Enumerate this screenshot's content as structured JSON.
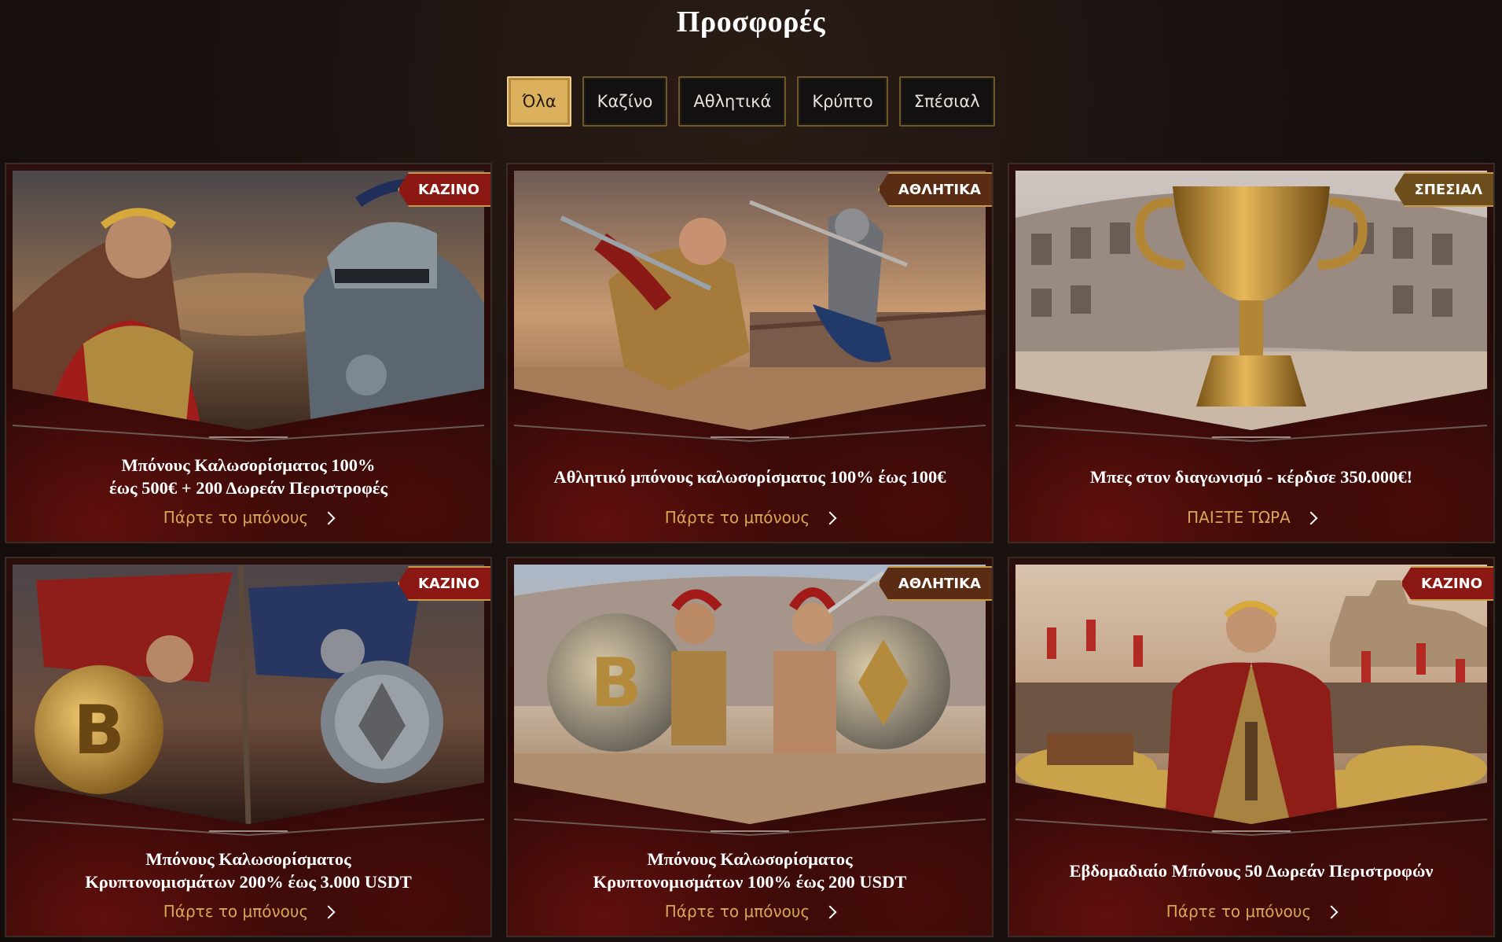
{
  "page": {
    "title": "Προσφορές"
  },
  "filters": [
    {
      "label": "Όλα",
      "active": true
    },
    {
      "label": "Καζίνο",
      "active": false
    },
    {
      "label": "Αθλητικά",
      "active": false
    },
    {
      "label": "Κρύπτο",
      "active": false
    },
    {
      "label": "Σπέσιαλ",
      "active": false
    }
  ],
  "colors": {
    "accent_gold": "#dcb15e",
    "link_gold": "#d8a658",
    "badge_red": "#8c1813",
    "badge_brown": "#5a2c14",
    "badge_gold": "#6e4d1d"
  },
  "offers": [
    {
      "badge": "ΚΑΖΙΝΟ",
      "title": "Μπόνους Καλωσορίσματος 100%\nέως 500€ + 200 Δωρεάν Περιστροφές",
      "cta": "Πάρτε το μπόνους",
      "image": "two-gladiators-laurel-helmet"
    },
    {
      "badge": "ΑΘΛΗΤΙΚΑ",
      "title": "Αθλητικό μπόνους καλωσορίσματος 100% έως 100€",
      "cta": "Πάρτε το μπόνους",
      "image": "gladiators-fighting-arena"
    },
    {
      "badge": "ΣΠΕΣΙΑΛ",
      "title": "Μπες στον διαγωνισμό - κέρδισε 350.000€!",
      "cta": "ΠΑΙΞΤΕ ΤΩΡΑ",
      "image": "golden-trophy-colosseum"
    },
    {
      "badge": "ΚΑΖΙΝΟ",
      "title": "Μπόνους Καλωσορίσματος\nΚρυπτονομισμάτων 200% έως 3.000 USDT",
      "cta": "Πάρτε το μπόνους",
      "image": "crypto-shield-warriors"
    },
    {
      "badge": "ΑΘΛΗΤΙΚΑ",
      "title": "Μπόνους Καλωσορίσματος\nΚρυπτονομισμάτων 100% έως 200 USDT",
      "cta": "Πάρτε το μπόνους",
      "image": "bitcoin-ethereum-gladiators"
    },
    {
      "badge": "ΚΑΖΙΝΟ",
      "title": "Εβδομαδιαίο Μπόνους 50 Δωρεάν Περιστροφών",
      "cta": "Πάρτε το μπόνους",
      "image": "emperor-gold-treasure"
    }
  ]
}
